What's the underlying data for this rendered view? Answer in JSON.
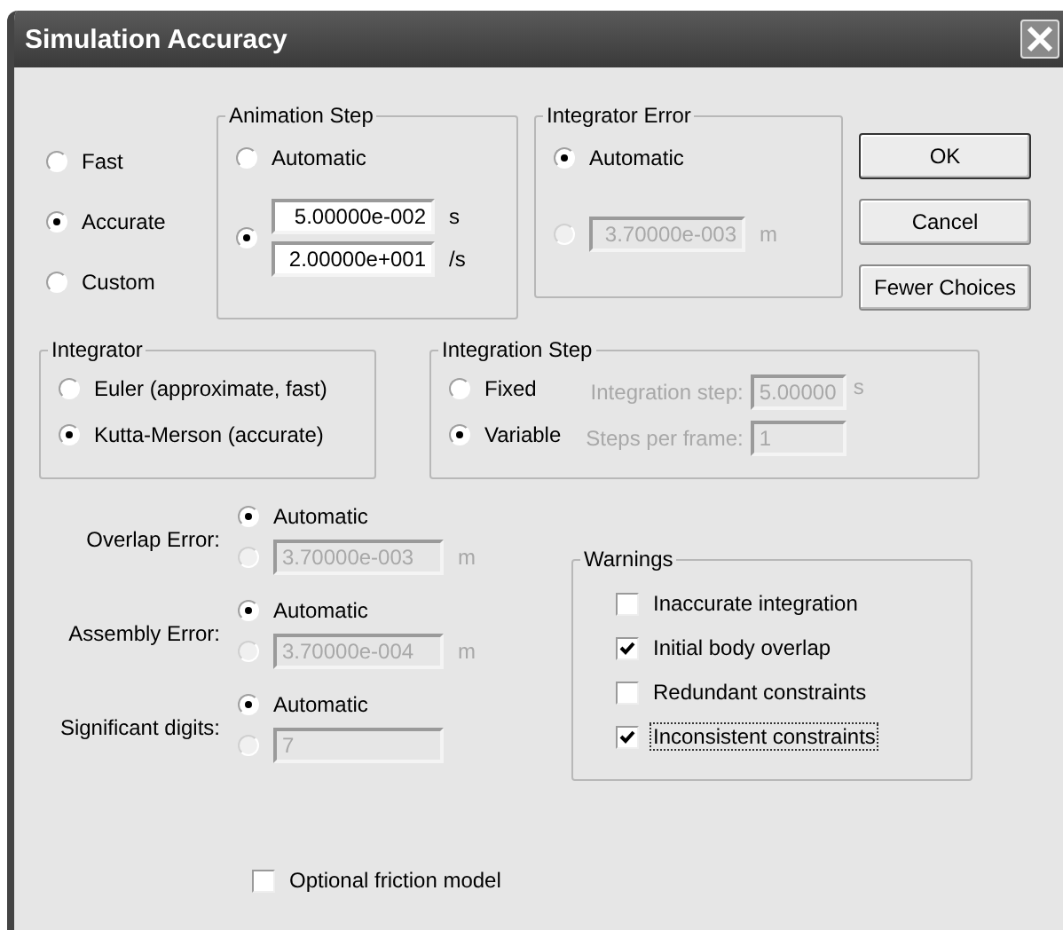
{
  "window": {
    "title": "Simulation Accuracy"
  },
  "accuracy_modes": [
    {
      "label": "Fast",
      "selected": false
    },
    {
      "label": "Accurate",
      "selected": true
    },
    {
      "label": "Custom",
      "selected": false
    }
  ],
  "animation_step": {
    "title": "Animation Step",
    "options": [
      {
        "kind": "label",
        "label": "Automatic",
        "selected": false,
        "disabled": false
      },
      {
        "kind": "fields",
        "selected": true,
        "disabled": false,
        "fields": [
          {
            "value": "5.00000e-002",
            "unit": "s"
          },
          {
            "value": "2.00000e+001",
            "unit": "/s"
          }
        ]
      }
    ]
  },
  "integrator_error": {
    "title": "Integrator Error",
    "options": [
      {
        "kind": "label",
        "label": "Automatic",
        "selected": true,
        "disabled": false
      },
      {
        "kind": "field",
        "selected": false,
        "disabled": true,
        "value": "3.70000e-003",
        "unit": "m"
      }
    ]
  },
  "buttons": [
    {
      "label": "OK",
      "default": true
    },
    {
      "label": "Cancel",
      "default": false
    },
    {
      "label": "Fewer Choices",
      "default": false
    }
  ],
  "integrator": {
    "title": "Integrator",
    "options": [
      {
        "kind": "label",
        "label": "Euler (approximate, fast)",
        "selected": false,
        "disabled": false
      },
      {
        "kind": "label",
        "label": "Kutta-Merson (accurate)",
        "selected": true,
        "disabled": false
      }
    ]
  },
  "integration_step": {
    "title": "Integration Step",
    "options": [
      {
        "kind": "label",
        "label": "Fixed",
        "selected": false,
        "disabled": false
      },
      {
        "kind": "label",
        "label": "Variable",
        "selected": true,
        "disabled": false
      }
    ],
    "fields": [
      {
        "label": "Integration step:",
        "value": "5.00000",
        "unit": "s",
        "disabled": true
      },
      {
        "label": "Steps per frame:",
        "value": "1",
        "disabled": true
      }
    ]
  },
  "error_settings": [
    {
      "label": "Overlap Error:",
      "options": [
        {
          "kind": "label",
          "label": "Automatic",
          "selected": true,
          "disabled": false
        },
        {
          "kind": "field",
          "selected": false,
          "disabled": true,
          "value": "3.70000e-003",
          "unit": "m"
        }
      ]
    },
    {
      "label": "Assembly Error:",
      "options": [
        {
          "kind": "label",
          "label": "Automatic",
          "selected": true,
          "disabled": false
        },
        {
          "kind": "field",
          "selected": false,
          "disabled": true,
          "value": "3.70000e-004",
          "unit": "m"
        }
      ]
    },
    {
      "label": "Significant digits:",
      "options": [
        {
          "kind": "label",
          "label": "Automatic",
          "selected": true,
          "disabled": false
        },
        {
          "kind": "field",
          "selected": false,
          "disabled": true,
          "value": "7"
        }
      ]
    }
  ],
  "warnings": {
    "title": "Warnings",
    "items": [
      {
        "label": "Inaccurate integration",
        "checked": false,
        "focused": false
      },
      {
        "label": "Initial body overlap",
        "checked": true,
        "focused": false
      },
      {
        "label": "Redundant constraints",
        "checked": false,
        "focused": false
      },
      {
        "label": "Inconsistent constraints",
        "checked": true,
        "focused": true
      }
    ]
  },
  "friction": {
    "label": "Optional friction model",
    "checked": false
  }
}
